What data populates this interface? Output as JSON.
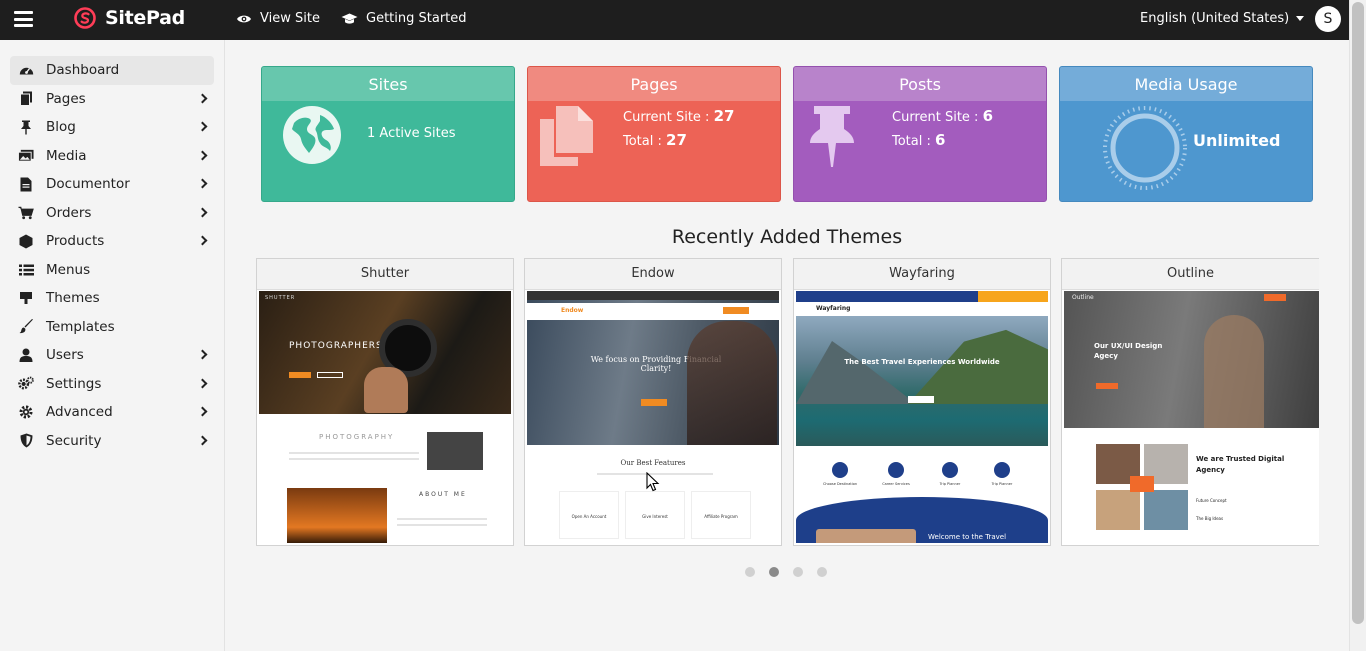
{
  "app": {
    "brand": "SitePad",
    "user_initial": "S",
    "language": "English (United States)"
  },
  "topnav": {
    "view_site": "View Site",
    "getting_started": "Getting Started"
  },
  "sidebar": {
    "items": [
      {
        "label": "Dashboard",
        "icon": "dashboard-icon"
      },
      {
        "label": "Pages",
        "icon": "pages-icon"
      },
      {
        "label": "Blog",
        "icon": "pin-icon"
      },
      {
        "label": "Media",
        "icon": "media-icon"
      },
      {
        "label": "Documentor",
        "icon": "document-icon"
      },
      {
        "label": "Orders",
        "icon": "cart-icon"
      },
      {
        "label": "Products",
        "icon": "box-icon"
      },
      {
        "label": "Menus",
        "icon": "list-icon"
      },
      {
        "label": "Themes",
        "icon": "themes-icon"
      },
      {
        "label": "Templates",
        "icon": "brush-icon"
      },
      {
        "label": "Users",
        "icon": "users-icon"
      },
      {
        "label": "Settings",
        "icon": "gears-icon"
      },
      {
        "label": "Advanced",
        "icon": "gear-icon"
      },
      {
        "label": "Security",
        "icon": "shield-icon"
      }
    ]
  },
  "cards": {
    "sites": {
      "title": "Sites",
      "text": "1 Active Sites"
    },
    "pages": {
      "title": "Pages",
      "current_label": "Current Site :",
      "current_value": "27",
      "total_label": "Total :",
      "total_value": "27"
    },
    "posts": {
      "title": "Posts",
      "current_label": "Current Site :",
      "current_value": "6",
      "total_label": "Total :",
      "total_value": "6"
    },
    "media": {
      "title": "Media Usage",
      "text": "Unlimited"
    }
  },
  "themes_section": {
    "title": "Recently Added Themes",
    "themes": [
      {
        "name": "Shutter",
        "preview_heading": "PHOTOGRAPHERS",
        "preview_brand": "SHUTTER",
        "preview_section": "PHOTOGRAPHY",
        "preview_about": "ABOUT ME"
      },
      {
        "name": "Endow",
        "preview_heading": "We focus on Providing Financial Clarity!",
        "preview_brand": "Endow",
        "preview_section": "Our Best Features",
        "preview_features": [
          "Open An Account",
          "Give Interest",
          "Affiliate Program"
        ]
      },
      {
        "name": "Wayfaring",
        "preview_heading": "The Best Travel Experiences Worldwide",
        "preview_brand": "Wayfaring",
        "preview_features": [
          "Choose Destination",
          "Career Services",
          "Trip Planner",
          "Trip Planner"
        ],
        "preview_footer": "Welcome to the Travel"
      },
      {
        "name": "Outline",
        "preview_heading": "Our UX/UI Design Agecy",
        "preview_brand": "Outline",
        "preview_section": "We are Trusted Digital Agency",
        "preview_features": [
          "Future Concept",
          "The Big Ideas"
        ]
      }
    ],
    "active_dot": 1
  }
}
